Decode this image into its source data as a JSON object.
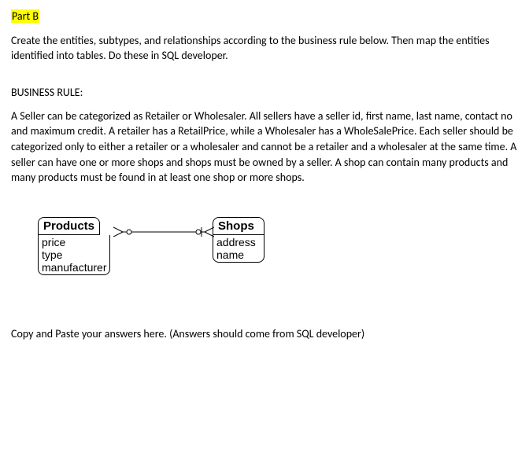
{
  "header": {
    "part_label": "Part B"
  },
  "intro": "Create the entities, subtypes, and relationships according to the business rule below.  Then map the entities identified into tables. Do these in SQL developer.",
  "rule": {
    "heading": "BUSINESS RULE:",
    "body": "A Seller can be categorized as Retailer or Wholesaler. All sellers have a seller id, first name, last name, contact no and maximum credit. A retailer has a RetailPrice, while a Wholesaler has a WholeSalePrice. Each seller should be categorized only to either a retailer or a wholesaler and cannot be a retailer and a wholesaler at the same time. A seller can have one or more shops and shops must be owned by a seller. A shop can contain many products and many products must be found in at least one shop or more shops."
  },
  "diagram": {
    "products": {
      "title": "Products",
      "attrs": [
        "price",
        "type",
        "manufacturer"
      ]
    },
    "shops": {
      "title": "Shops",
      "attrs": [
        "address",
        "name"
      ]
    }
  },
  "footer": "Copy and Paste your answers here.  (Answers should come from SQL developer)"
}
